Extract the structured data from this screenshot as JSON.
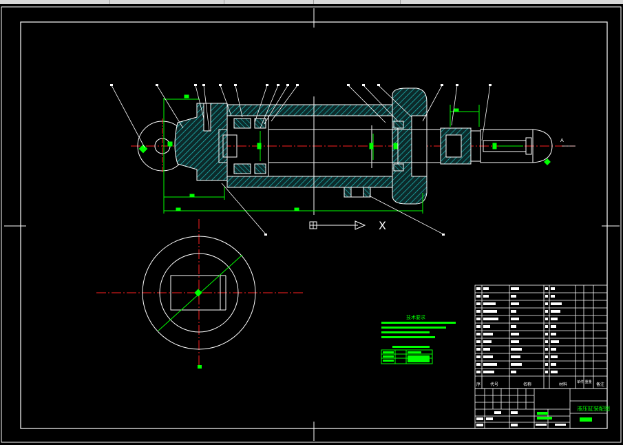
{
  "window": {
    "tabs": [
      "",
      "",
      "",
      ""
    ]
  },
  "drawing": {
    "colors": {
      "background": "#000000",
      "outline": "#ffffff",
      "centerline": "#ff2020",
      "dimension": "#00ff00",
      "hatch": "#1fbfbf"
    },
    "view_axis_label": "X",
    "section_label": "A",
    "tech_requirements": {
      "title": "技术要求"
    },
    "title_block": {
      "header": {
        "seq": "序",
        "code": "代号",
        "name": "名称",
        "material": "材料",
        "weight": "单件 重量",
        "note": "备注"
      },
      "drawing_title": "液压缸装配图"
    }
  }
}
